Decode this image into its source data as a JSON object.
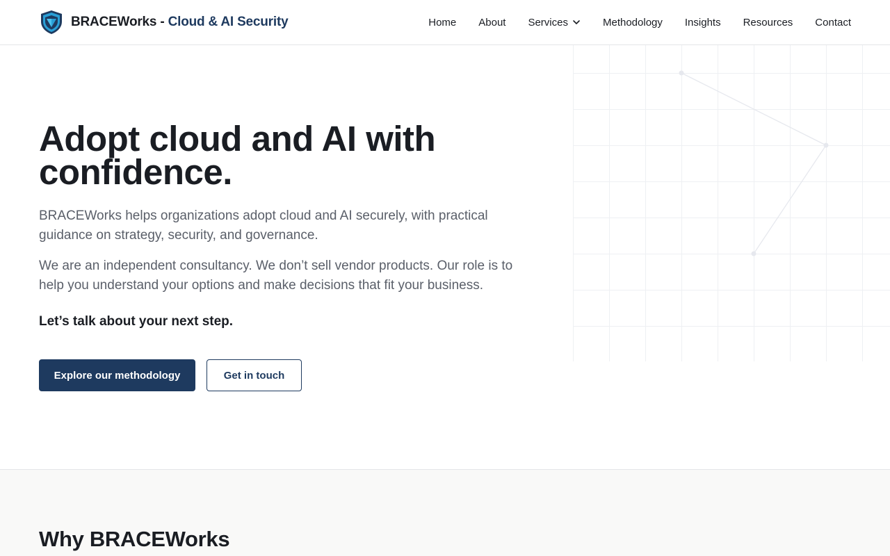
{
  "brand": {
    "name": "BRACEWorks",
    "separator": " - ",
    "tagline": "Cloud & AI Security",
    "logo_icon": "shield-icon",
    "colors": {
      "dark": "#1e3a5f",
      "accent": "#2a9fd6"
    }
  },
  "nav": {
    "items": [
      {
        "label": "Home"
      },
      {
        "label": "About"
      },
      {
        "label": "Services",
        "icon": "chevron-down-icon"
      },
      {
        "label": "Methodology"
      },
      {
        "label": "Insights"
      },
      {
        "label": "Resources"
      },
      {
        "label": "Contact"
      }
    ]
  },
  "hero": {
    "title": "Adopt cloud and AI with confidence.",
    "paragraph1": "BRACEWorks helps organizations adopt cloud and AI securely, with practical guidance on strategy, security, and governance.",
    "paragraph2": "We are an independent consultancy. We don’t sell vendor products. Our role is to help you understand your options and make decisions that fit your business.",
    "cta_text": "Let’s talk about your next step.",
    "primary_button": "Explore our methodology",
    "secondary_button": "Get in touch"
  },
  "why": {
    "title": "Why BRACEWorks"
  },
  "colors": {
    "primary": "#1e3a5f",
    "text": "#1a1d23",
    "muted": "#5a5f69",
    "section_bg": "#f9f9f8"
  }
}
